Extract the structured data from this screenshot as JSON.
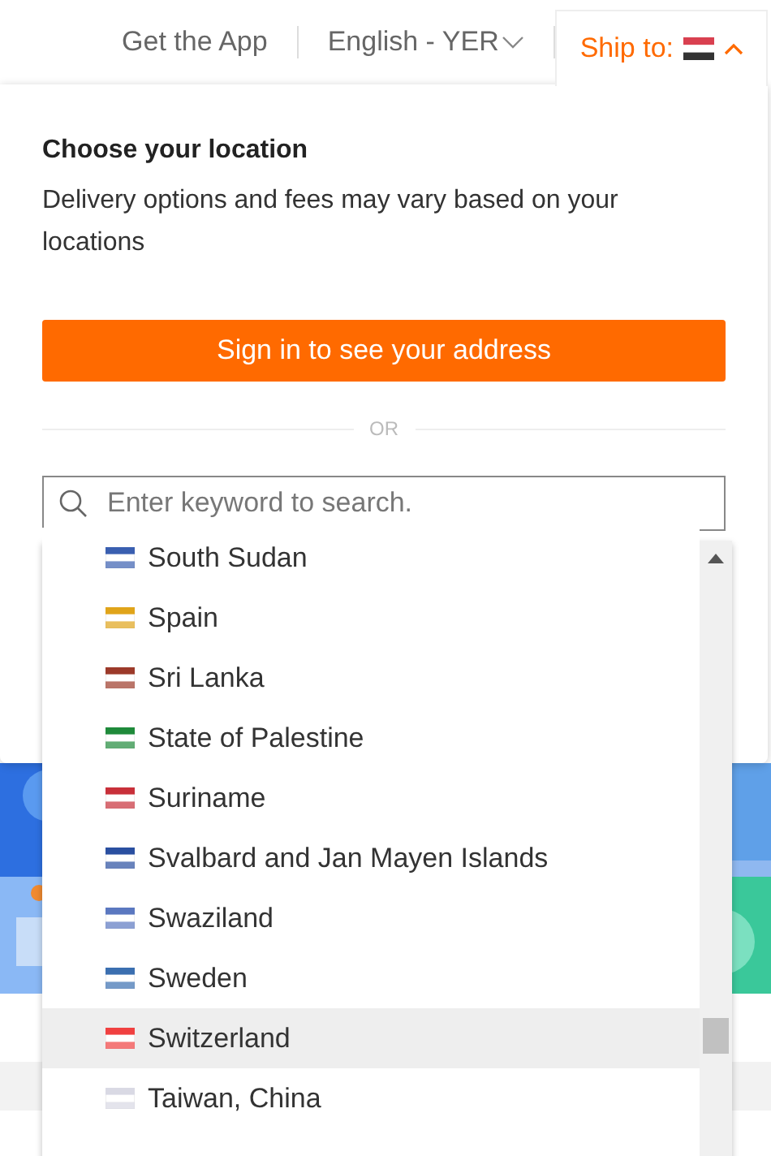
{
  "top_bar": {
    "get_app": "Get the App",
    "language": "English - YER",
    "ship_to": {
      "label": "Ship to:",
      "expanded": true
    }
  },
  "location_popup": {
    "title": "Choose your location",
    "description": "Delivery options and fees may vary based on your locations",
    "sign_in_button": "Sign in to see your address",
    "divider": "OR",
    "search": {
      "placeholder": "Enter keyword to search."
    },
    "countries": [
      {
        "name": "South Sudan",
        "color": "#3a5fb0",
        "selected": false
      },
      {
        "name": "Spain",
        "color": "#e0a41a",
        "selected": false
      },
      {
        "name": "Sri Lanka",
        "color": "#9c3a2a",
        "selected": false
      },
      {
        "name": "State of Palestine",
        "color": "#1f8a3a",
        "selected": false
      },
      {
        "name": "Suriname",
        "color": "#c8303a",
        "selected": false
      },
      {
        "name": "Svalbard and Jan Mayen Islands",
        "color": "#2a4fa0",
        "selected": false
      },
      {
        "name": "Swaziland",
        "color": "#5b78c0",
        "selected": false
      },
      {
        "name": "Sweden",
        "color": "#3b6fb0",
        "selected": false
      },
      {
        "name": "Switzerland",
        "color": "#f04040",
        "selected": true
      },
      {
        "name": "Taiwan, China",
        "color": "#d9d9e4",
        "selected": false
      }
    ]
  }
}
